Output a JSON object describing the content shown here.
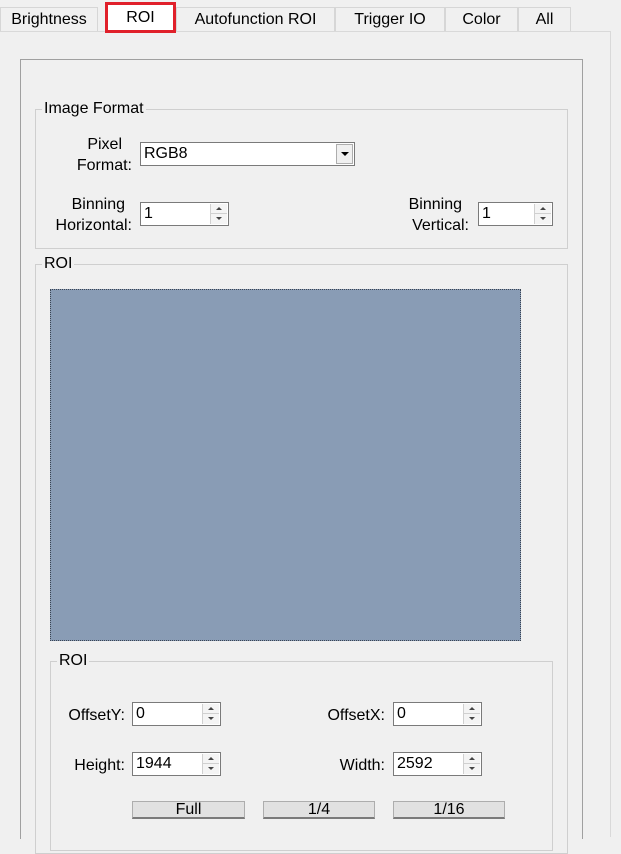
{
  "tabs": [
    {
      "label": "Brightness",
      "active": false
    },
    {
      "label": "ROI",
      "active": true
    },
    {
      "label": "Autofunction ROI",
      "active": false
    },
    {
      "label": "Trigger IO",
      "active": false
    },
    {
      "label": "Color",
      "active": false
    },
    {
      "label": "All",
      "active": false
    }
  ],
  "image_format": {
    "title": "Image Format",
    "pixel_format_label_1": "Pixel",
    "pixel_format_label_2": "Format:",
    "pixel_format_value": "RGB8",
    "binning_h_label_1": "Binning",
    "binning_h_label_2": "Horizontal:",
    "binning_h_value": "1",
    "binning_v_label_1": "Binning",
    "binning_v_label_2": "Vertical:",
    "binning_v_value": "1"
  },
  "roi_group": {
    "title": "ROI"
  },
  "roi_sub": {
    "title": "ROI",
    "offset_y_label": "OffsetY:",
    "offset_y_value": "0",
    "offset_x_label": "OffsetX:",
    "offset_x_value": "0",
    "height_label": "Height:",
    "height_value": "1944",
    "width_label": "Width:",
    "width_value": "2592",
    "full_label": "Full",
    "quarter_label": "1/4",
    "sixteenth_label": "1/16"
  },
  "colors": {
    "preview_fill": "#899cb5",
    "highlight": "#e0202a"
  }
}
